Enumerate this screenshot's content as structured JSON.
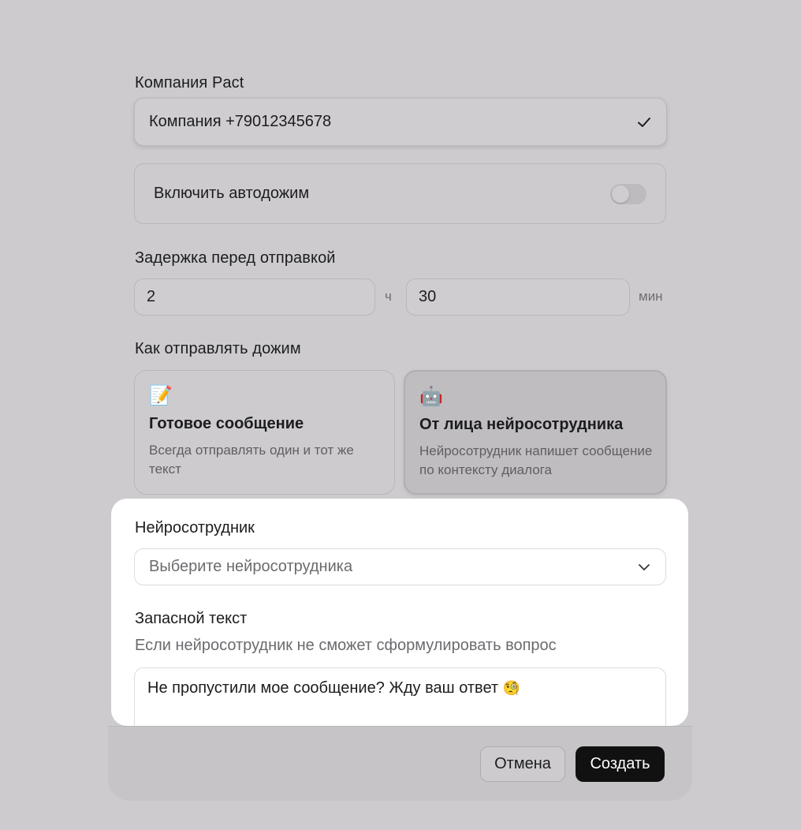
{
  "company": {
    "label": "Компания Pact",
    "value": "Компания +79012345678",
    "check_icon": "check-icon"
  },
  "autofollow": {
    "label": "Включить автодожим",
    "enabled": false
  },
  "delay": {
    "label": "Задержка перед отправкой",
    "hours_value": "2",
    "hours_unit": "ч",
    "minutes_value": "30",
    "minutes_unit": "мин"
  },
  "send_mode": {
    "label": "Как отправлять дожим",
    "options": [
      {
        "emoji": "📝",
        "title": "Готовое сообщение",
        "description": "Всегда отправлять один и тот же текст",
        "selected": false
      },
      {
        "emoji": "🤖",
        "title": "От лица нейросотрудника",
        "description": "Нейросотрудник напишет сообщение по контексту диалога",
        "selected": true
      }
    ]
  },
  "agent": {
    "label": "Нейросотрудник",
    "placeholder": "Выберите нейросотрудника"
  },
  "fallback": {
    "label": "Запасной текст",
    "hint": "Если нейросотрудник не сможет сформулировать вопрос",
    "text": "Не пропустили мое сообщение? Жду ваш ответ",
    "emoji": "🧐"
  },
  "footer": {
    "cancel_label": "Отмена",
    "create_label": "Создать"
  }
}
